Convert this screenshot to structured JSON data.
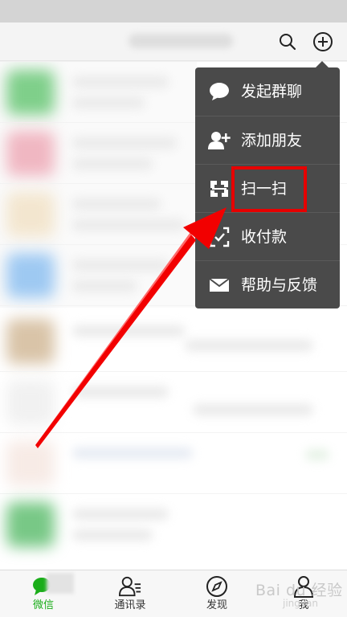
{
  "menu": {
    "items": [
      {
        "label": "发起群聊",
        "icon": "chat-bubble-icon"
      },
      {
        "label": "添加朋友",
        "icon": "add-friend-icon"
      },
      {
        "label": "扫一扫",
        "icon": "scan-icon"
      },
      {
        "label": "收付款",
        "icon": "payment-icon"
      },
      {
        "label": "帮助与反馈",
        "icon": "mail-icon"
      }
    ]
  },
  "tabs": [
    {
      "label": "微信",
      "icon": "chats-icon",
      "active": true
    },
    {
      "label": "通讯录",
      "icon": "contacts-icon",
      "active": false
    },
    {
      "label": "发现",
      "icon": "discover-icon",
      "active": false
    },
    {
      "label": "我",
      "icon": "me-icon",
      "active": false
    }
  ],
  "header": {
    "icons": [
      "search-icon",
      "add-icon"
    ]
  },
  "watermark": {
    "text": "Bai du 经验",
    "sub": "jingyan"
  },
  "colors": {
    "accent": "#1aad19",
    "menu_bg": "#4a4a4a",
    "highlight": "#e60000"
  }
}
